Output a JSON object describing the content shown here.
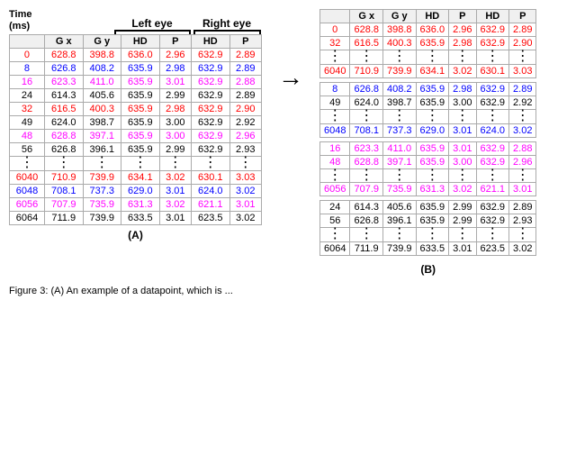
{
  "headers": {
    "left_eye": "Left eye",
    "right_eye": "Right eye",
    "time_label": "Time\n(ms)",
    "cols_a": [
      "G x",
      "G y",
      "HD",
      "P",
      "HD",
      "P"
    ],
    "cols_b": [
      "",
      "G x",
      "G y",
      "HD",
      "P",
      "HD",
      "P"
    ]
  },
  "table_a": {
    "label": "(A)",
    "rows": [
      {
        "time": "0",
        "color": "red",
        "gx": "628.8",
        "gy": "398.8",
        "hd_l": "636.0",
        "p_l": "2.96",
        "hd_r": "632.9",
        "p_r": "2.89"
      },
      {
        "time": "8",
        "color": "blue",
        "gx": "626.8",
        "gy": "408.2",
        "hd_l": "635.9",
        "p_l": "2.98",
        "hd_r": "632.9",
        "p_r": "2.89"
      },
      {
        "time": "16",
        "color": "magenta",
        "gx": "623.3",
        "gy": "411.0",
        "hd_l": "635.9",
        "p_l": "3.01",
        "hd_r": "632.9",
        "p_r": "2.88"
      },
      {
        "time": "24",
        "color": "normal",
        "gx": "614.3",
        "gy": "405.6",
        "hd_l": "635.9",
        "p_l": "2.99",
        "hd_r": "632.9",
        "p_r": "2.89"
      },
      {
        "time": "32",
        "color": "red",
        "gx": "616.5",
        "gy": "400.3",
        "hd_l": "635.9",
        "p_l": "2.98",
        "hd_r": "632.9",
        "p_r": "2.90"
      },
      {
        "time": "49",
        "color": "normal",
        "gx": "624.0",
        "gy": "398.7",
        "hd_l": "635.9",
        "p_l": "3.00",
        "hd_r": "632.9",
        "p_r": "2.92"
      },
      {
        "time": "48",
        "color": "magenta",
        "gx": "628.8",
        "gy": "397.1",
        "hd_l": "635.9",
        "p_l": "3.00",
        "hd_r": "632.9",
        "p_r": "2.96"
      },
      {
        "time": "56",
        "color": "normal",
        "gx": "626.8",
        "gy": "396.1",
        "hd_l": "635.9",
        "p_l": "2.99",
        "hd_r": "632.9",
        "p_r": "2.93"
      },
      {
        "time": "⋮",
        "color": "normal",
        "gx": "⋮",
        "gy": "⋮",
        "hd_l": "⋮",
        "p_l": "⋮",
        "hd_r": "⋮",
        "p_r": "⋮",
        "dots": true
      },
      {
        "time": "6040",
        "color": "red",
        "gx": "710.9",
        "gy": "739.9",
        "hd_l": "634.1",
        "p_l": "3.02",
        "hd_r": "630.1",
        "p_r": "3.03"
      },
      {
        "time": "6048",
        "color": "blue",
        "gx": "708.1",
        "gy": "737.3",
        "hd_l": "629.0",
        "p_l": "3.01",
        "hd_r": "624.0",
        "p_r": "3.02"
      },
      {
        "time": "6056",
        "color": "magenta",
        "gx": "707.9",
        "gy": "735.9",
        "hd_l": "631.3",
        "p_l": "3.02",
        "hd_r": "621.1",
        "p_r": "3.01"
      },
      {
        "time": "6064",
        "color": "normal",
        "gx": "711.9",
        "gy": "739.9",
        "hd_l": "633.5",
        "p_l": "3.01",
        "hd_r": "623.5",
        "p_r": "3.02"
      }
    ]
  },
  "table_b": {
    "label": "(B)",
    "groups": [
      {
        "rows": [
          {
            "time": "0",
            "color": "red",
            "gx": "628.8",
            "gy": "398.8",
            "hd_l": "636.0",
            "p_l": "2.96",
            "hd_r": "632.9",
            "p_r": "2.89"
          },
          {
            "time": "32",
            "color": "red",
            "gx": "616.5",
            "gy": "400.3",
            "hd_l": "635.9",
            "p_l": "2.98",
            "hd_r": "632.9",
            "p_r": "2.90"
          },
          {
            "time": "⋮",
            "color": "normal",
            "gx": "⋮",
            "gy": "⋮",
            "hd_l": "⋮",
            "p_l": "⋮",
            "hd_r": "⋮",
            "p_r": "⋮",
            "dots": true
          },
          {
            "time": "6040",
            "color": "red",
            "gx": "710.9",
            "gy": "739.9",
            "hd_l": "634.1",
            "p_l": "3.02",
            "hd_r": "630.1",
            "p_r": "3.03"
          }
        ]
      },
      {
        "rows": [
          {
            "time": "8",
            "color": "blue",
            "gx": "626.8",
            "gy": "408.2",
            "hd_l": "635.9",
            "p_l": "2.98",
            "hd_r": "632.9",
            "p_r": "2.89"
          },
          {
            "time": "49",
            "color": "normal",
            "gx": "624.0",
            "gy": "398.7",
            "hd_l": "635.9",
            "p_l": "3.00",
            "hd_r": "632.9",
            "p_r": "2.92"
          },
          {
            "time": "⋮",
            "color": "normal",
            "gx": "⋮",
            "gy": "⋮",
            "hd_l": "⋮",
            "p_l": "⋮",
            "hd_r": "⋮",
            "p_r": "⋮",
            "dots": true
          },
          {
            "time": "6048",
            "color": "blue",
            "gx": "708.1",
            "gy": "737.3",
            "hd_l": "629.0",
            "p_l": "3.01",
            "hd_r": "624.0",
            "p_r": "3.02"
          }
        ]
      },
      {
        "rows": [
          {
            "time": "16",
            "color": "magenta",
            "gx": "623.3",
            "gy": "411.0",
            "hd_l": "635.9",
            "p_l": "3.01",
            "hd_r": "632.9",
            "p_r": "2.88"
          },
          {
            "time": "48",
            "color": "magenta",
            "gx": "628.8",
            "gy": "397.1",
            "hd_l": "635.9",
            "p_l": "3.00",
            "hd_r": "632.9",
            "p_r": "2.96"
          },
          {
            "time": "⋮",
            "color": "normal",
            "gx": "⋮",
            "gy": "⋮",
            "hd_l": "⋮",
            "p_l": "⋮",
            "hd_r": "⋮",
            "p_r": "⋮",
            "dots": true
          },
          {
            "time": "6056",
            "color": "magenta",
            "gx": "707.9",
            "gy": "735.9",
            "hd_l": "631.3",
            "p_l": "3.02",
            "hd_r": "621.1",
            "p_r": "3.01"
          }
        ]
      },
      {
        "rows": [
          {
            "time": "24",
            "color": "normal",
            "gx": "614.3",
            "gy": "405.6",
            "hd_l": "635.9",
            "p_l": "2.99",
            "hd_r": "632.9",
            "p_r": "2.89"
          },
          {
            "time": "56",
            "color": "normal",
            "gx": "626.8",
            "gy": "396.1",
            "hd_l": "635.9",
            "p_l": "2.99",
            "hd_r": "632.9",
            "p_r": "2.93"
          },
          {
            "time": "⋮",
            "color": "normal",
            "gx": "⋮",
            "gy": "⋮",
            "hd_l": "⋮",
            "p_l": "⋮",
            "hd_r": "⋮",
            "p_r": "⋮",
            "dots": true
          },
          {
            "time": "6064",
            "color": "normal",
            "gx": "711.9",
            "gy": "739.9",
            "hd_l": "633.5",
            "p_l": "3.01",
            "hd_r": "623.5",
            "p_r": "3.02"
          }
        ]
      }
    ]
  },
  "caption": {
    "text": "Figure 3: (A) An example of a datapoint, which is ..."
  },
  "arrow": "→"
}
